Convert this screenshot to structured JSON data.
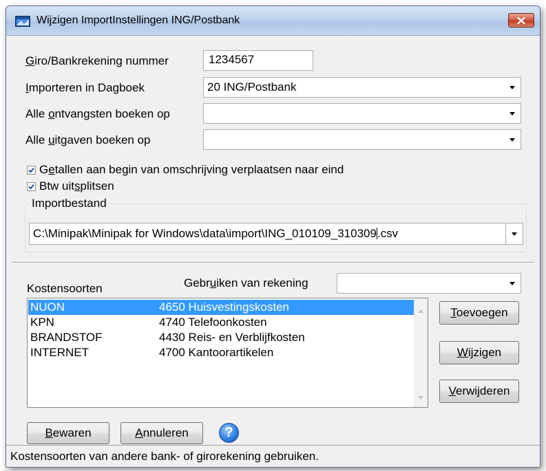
{
  "window": {
    "title": "Wijzigen ImportInstellingen ING/Postbank"
  },
  "form": {
    "account": {
      "label_ul": "G",
      "label_rest": "iro/Bankrekening nummer",
      "value": "1234567"
    },
    "journal": {
      "label_ul": "I",
      "label_rest": "mporteren in Dagboek",
      "value": "20 ING/Postbank"
    },
    "receipts": {
      "label_pre": "Alle ",
      "label_ul": "o",
      "label_rest": "ntvangsten boeken op",
      "value": ""
    },
    "expenses": {
      "label_pre": "Alle ",
      "label_ul": "u",
      "label_rest": "itgaven boeken op",
      "value": ""
    },
    "move_numbers": {
      "label_pre": "G",
      "label_ul": "e",
      "label_rest": "tallen aan begin van omschrijving verplaatsen naar eind",
      "checked": true
    },
    "split_vat": {
      "label_pre": "Btw uit",
      "label_ul": "s",
      "label_rest": "plitsen",
      "checked": true
    }
  },
  "importfile": {
    "legend": "Importbestand",
    "path_before_caret": "C:\\Minipak\\Minipak for Windows\\data\\import\\ING_010109_310309",
    "path_after_caret": ".csv"
  },
  "costtypes": {
    "label": "Kostensoorten",
    "use_account_label_pre": "Gebr",
    "use_account_label_ul": "u",
    "use_account_label_rest": "iken van rekening",
    "use_account_value": "",
    "rows": [
      {
        "name": "NUON",
        "account": "4650 Huisvestingskosten",
        "selected": true
      },
      {
        "name": "KPN",
        "account": "4740 Telefoonkosten",
        "selected": false
      },
      {
        "name": "BRANDSTOF",
        "account": "4430 Reis- en Verblijfkosten",
        "selected": false
      },
      {
        "name": "INTERNET",
        "account": "4700 Kantoorartikelen",
        "selected": false
      }
    ]
  },
  "buttons": {
    "add": {
      "ul": "T",
      "rest": "oevoegen"
    },
    "edit": {
      "ul": "W",
      "rest": "ijzigen"
    },
    "delete": {
      "ul": "V",
      "rest": "erwijderen"
    },
    "save": {
      "ul": "B",
      "rest": "ewaren"
    },
    "cancel": {
      "ul": "A",
      "rest": "nnuleren"
    }
  },
  "status": {
    "text": "Kostensoorten van andere bank- of girorekening gebruiken."
  },
  "colors": {
    "selection": "#3399ff",
    "help_icon": "#2f7fe0",
    "close_button": "#c33b22"
  },
  "icons": {
    "app": "app-window-icon",
    "close": "close-icon",
    "help": "help-icon",
    "dropdown": "chevron-down-icon",
    "check": "checkmark-icon"
  }
}
